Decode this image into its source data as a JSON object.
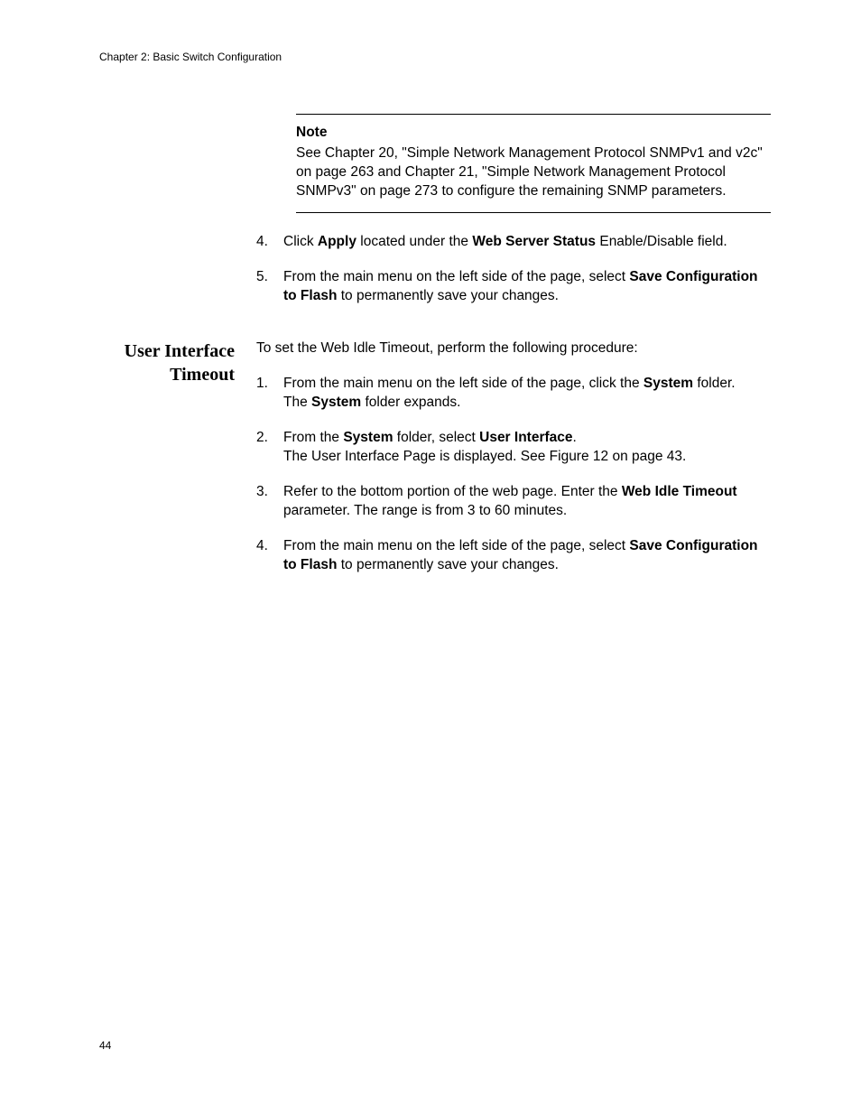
{
  "chapterHeader": "Chapter 2: Basic Switch Configuration",
  "noteTitle": "Note",
  "noteBody": "See Chapter 20, \"Simple Network Management Protocol SNMPv1 and v2c\" on page 263 and Chapter 21, \"Simple Network Management Protocol SNMPv3\" on page 273 to configure the remaining SNMP parameters.",
  "listA": {
    "item4": {
      "num": "4.",
      "pre": "Click ",
      "b1": "Apply",
      "mid": " located under the ",
      "b2": "Web Server Status",
      "post": " Enable/Disable field."
    },
    "item5": {
      "num": "5.",
      "pre": "From the main menu on the left side of the page, select ",
      "b1": "Save Configuration to Flash",
      "post": " to permanently save your changes."
    }
  },
  "section2": {
    "headingLine1": "User Interface",
    "headingLine2": "Timeout",
    "intro": "To set the Web Idle Timeout, perform the following procedure:"
  },
  "listB": {
    "item1": {
      "num": "1.",
      "pre": "From the main menu on the left side of the page, click the ",
      "b1": "System",
      "post1": " folder.",
      "line2a": "The ",
      "line2b": "System",
      "line2c": " folder expands."
    },
    "item2": {
      "num": "2.",
      "pre": "From the ",
      "b1": "System",
      "mid": " folder, select ",
      "b2": "User Interface",
      "post": ".",
      "line2": "The User Interface Page is displayed. See Figure 12 on page 43."
    },
    "item3": {
      "num": "3.",
      "pre": "Refer to the bottom portion of the web page. Enter the ",
      "b1": "Web Idle Timeout",
      "post": " parameter. The range is from 3 to 60 minutes."
    },
    "item4": {
      "num": "4.",
      "pre": "From the main menu on the left side of the page, select ",
      "b1": "Save Configuration to Flash",
      "post": " to permanently save your changes."
    }
  },
  "pageNumber": "44"
}
